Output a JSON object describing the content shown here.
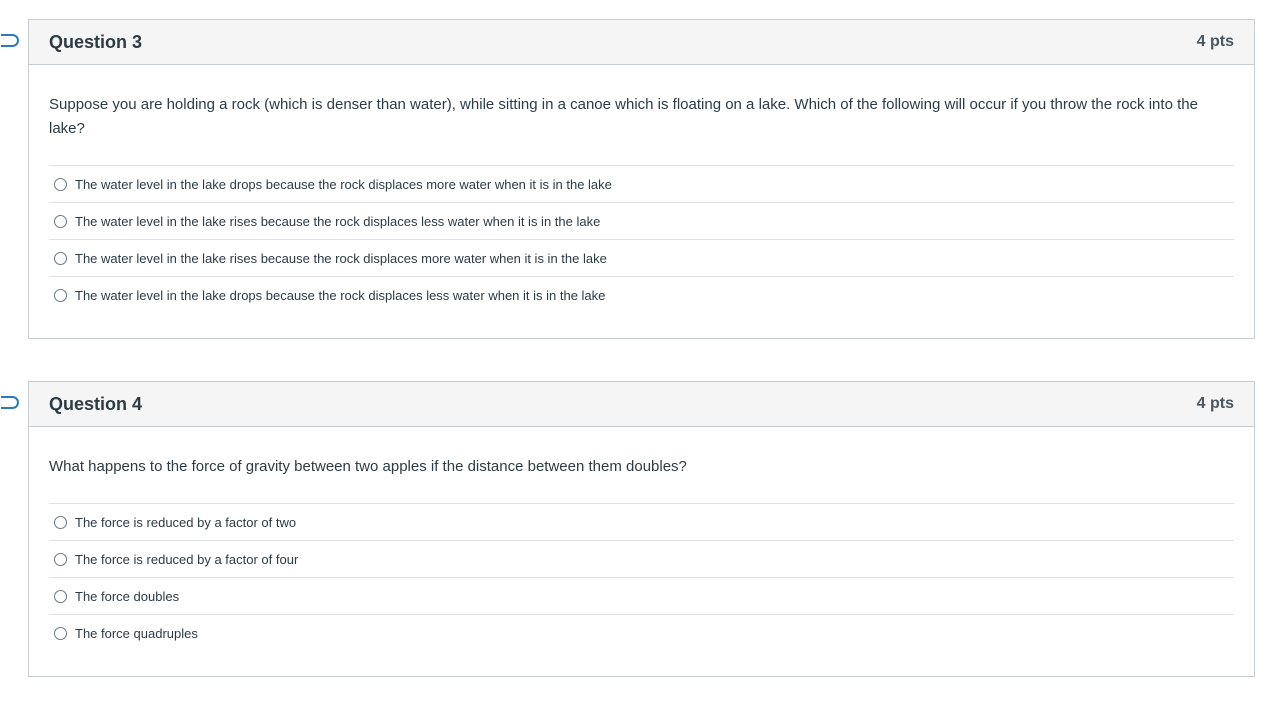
{
  "questions": [
    {
      "title": "Question 3",
      "points": "4 pts",
      "text": "Suppose you are holding a rock (which is denser than water), while sitting in a canoe which is floating on a lake.  Which of the following will occur if you throw the rock into the lake?",
      "answers": [
        "The water level in the lake drops because the rock displaces more water when it is in the lake",
        "The water level in the lake rises because the rock displaces less water when it is in the lake",
        "The water level in the lake rises because the rock displaces more water when it is in the lake",
        "The water level in the lake drops because the rock displaces less water when it is in the lake"
      ]
    },
    {
      "title": "Question 4",
      "points": "4 pts",
      "text": "What happens to the force of gravity between two apples if the distance between them doubles?",
      "answers": [
        "The force is reduced by a factor of two",
        "The force is reduced by a factor of four",
        "The force doubles",
        "The force quadruples"
      ]
    }
  ],
  "colors": {
    "flag": "#2b7abc",
    "header_bg": "#f5f5f5",
    "border": "#c7cdd1",
    "text": "#2d3b45"
  },
  "icons": {
    "flag": "bookmark-flag-icon",
    "radio": "radio-button-icon"
  }
}
